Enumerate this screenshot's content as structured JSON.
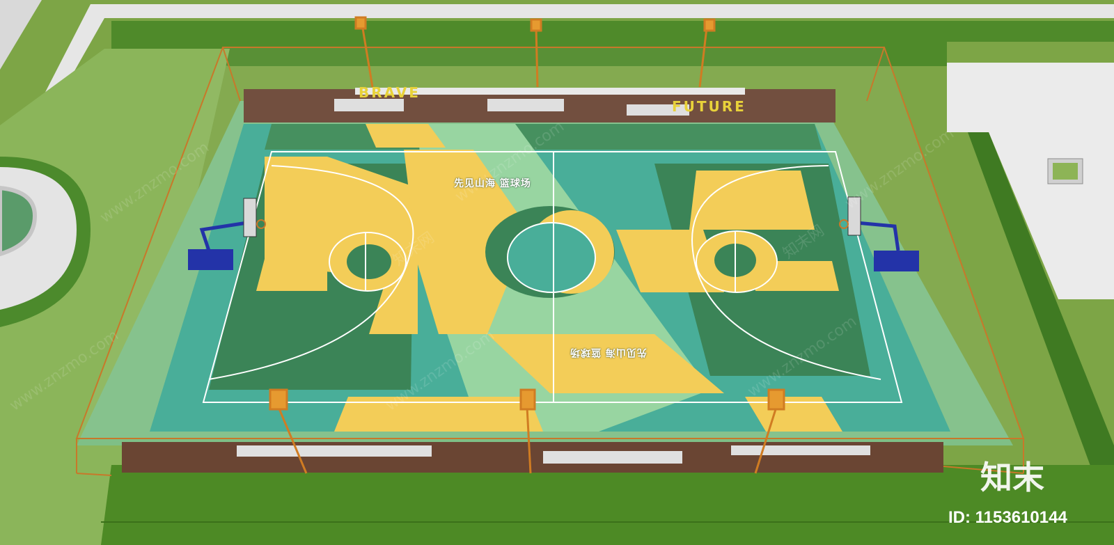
{
  "court": {
    "top_label": "先见山海 篮球场",
    "bottom_label": "先见山海 篮球场",
    "bench_sign_left": "BRAVE",
    "bench_sign_right": "FUTURE"
  },
  "watermark": {
    "logo": "知末",
    "id_text": "ID: 1153610144",
    "repeat_text": "www.znzmo.com",
    "repeat_text_cn": "知末网"
  },
  "colors": {
    "grass": "#6f9a3a",
    "grass_dark": "#4f7f25",
    "court_teal": "#3aa48f",
    "court_dark_green": "#2f7a4f",
    "court_light_green": "#8fcf9a",
    "court_yellow": "#f1c84f",
    "fence_orange": "#c8782a",
    "hoop_blue": "#2333a8",
    "bench_brown": "#6a4533"
  }
}
